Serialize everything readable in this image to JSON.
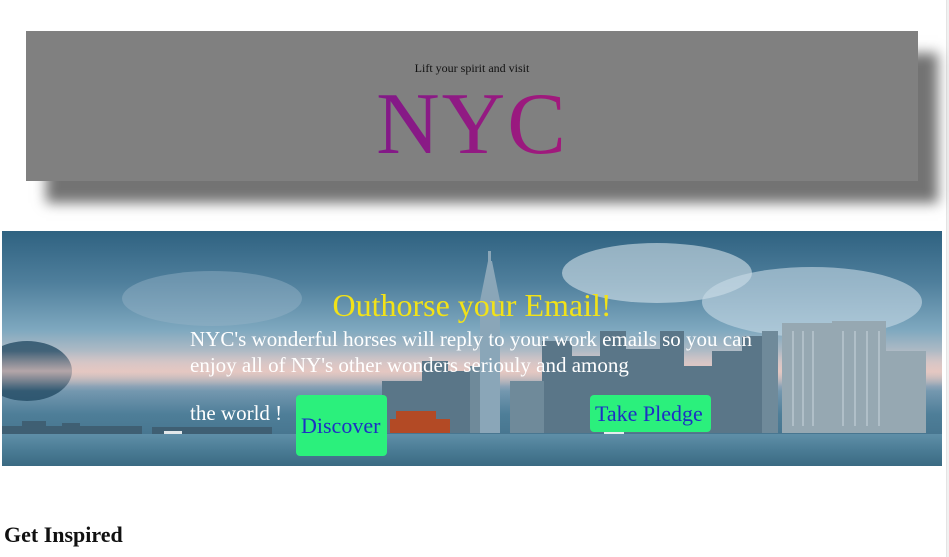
{
  "header": {
    "tagline": "Lift your spirit and visit",
    "title": "NYC",
    "title_gradient": [
      "#4a1290",
      "#8a1a86",
      "#e0155f"
    ],
    "background": "#808080"
  },
  "hero": {
    "title": "Outhorse your Email!",
    "body_text": "NYC's wonderful horses will reply to your work emails so you can enjoy all of NY's other wonders seriouly and among",
    "tail_text": "the world !",
    "title_color": "#f2e218",
    "buttons": {
      "discover_label": "Discover",
      "pledge_label": "Take Pledge",
      "button_color": "#2bf07c",
      "button_text_color": "#1d2fc4"
    }
  },
  "sections": {
    "inspired_heading": "Get Inspired"
  }
}
